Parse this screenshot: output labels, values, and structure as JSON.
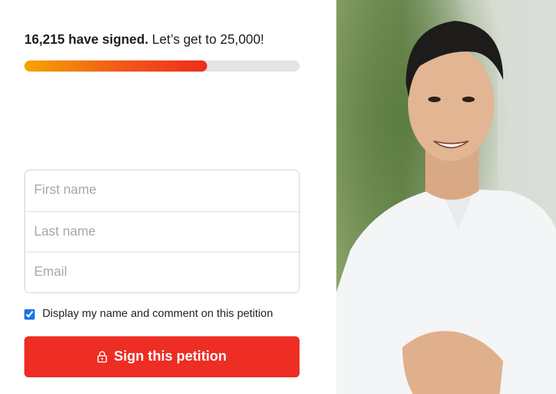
{
  "progress": {
    "signed_count_text": "16,215 have signed.",
    "goal_text": "Let’s get to 25,000!",
    "signed": 16215,
    "goal": 25000,
    "fill_fraction": 0.665
  },
  "form": {
    "first_name_placeholder": "First name",
    "last_name_placeholder": "Last name",
    "email_placeholder": "Email"
  },
  "display_consent": {
    "label": "Display my name and comment on this petition",
    "checked": true
  },
  "sign_button": {
    "label": "Sign this petition",
    "icon": "lock-icon"
  },
  "colors": {
    "accent": "#ee2d24",
    "progress_start": "#f6a400",
    "progress_end": "#ee2d1c"
  }
}
